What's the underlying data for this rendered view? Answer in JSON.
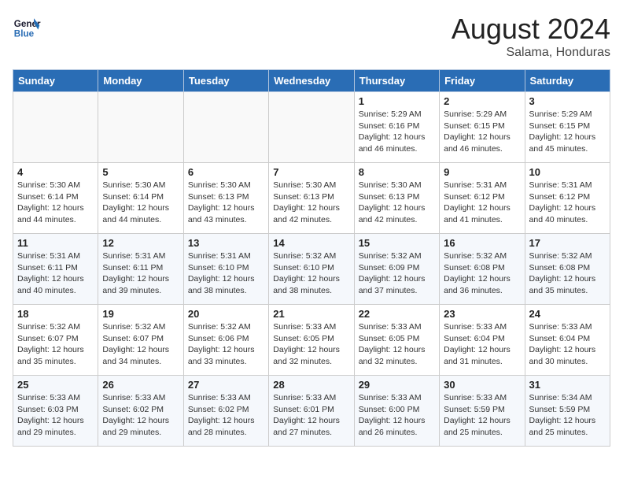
{
  "header": {
    "logo_general": "General",
    "logo_blue": "Blue",
    "month_year": "August 2024",
    "location": "Salama, Honduras"
  },
  "weekdays": [
    "Sunday",
    "Monday",
    "Tuesday",
    "Wednesday",
    "Thursday",
    "Friday",
    "Saturday"
  ],
  "weeks": [
    [
      {
        "day": "",
        "info": ""
      },
      {
        "day": "",
        "info": ""
      },
      {
        "day": "",
        "info": ""
      },
      {
        "day": "",
        "info": ""
      },
      {
        "day": "1",
        "info": "Sunrise: 5:29 AM\nSunset: 6:16 PM\nDaylight: 12 hours\nand 46 minutes."
      },
      {
        "day": "2",
        "info": "Sunrise: 5:29 AM\nSunset: 6:15 PM\nDaylight: 12 hours\nand 46 minutes."
      },
      {
        "day": "3",
        "info": "Sunrise: 5:29 AM\nSunset: 6:15 PM\nDaylight: 12 hours\nand 45 minutes."
      }
    ],
    [
      {
        "day": "4",
        "info": "Sunrise: 5:30 AM\nSunset: 6:14 PM\nDaylight: 12 hours\nand 44 minutes."
      },
      {
        "day": "5",
        "info": "Sunrise: 5:30 AM\nSunset: 6:14 PM\nDaylight: 12 hours\nand 44 minutes."
      },
      {
        "day": "6",
        "info": "Sunrise: 5:30 AM\nSunset: 6:13 PM\nDaylight: 12 hours\nand 43 minutes."
      },
      {
        "day": "7",
        "info": "Sunrise: 5:30 AM\nSunset: 6:13 PM\nDaylight: 12 hours\nand 42 minutes."
      },
      {
        "day": "8",
        "info": "Sunrise: 5:30 AM\nSunset: 6:13 PM\nDaylight: 12 hours\nand 42 minutes."
      },
      {
        "day": "9",
        "info": "Sunrise: 5:31 AM\nSunset: 6:12 PM\nDaylight: 12 hours\nand 41 minutes."
      },
      {
        "day": "10",
        "info": "Sunrise: 5:31 AM\nSunset: 6:12 PM\nDaylight: 12 hours\nand 40 minutes."
      }
    ],
    [
      {
        "day": "11",
        "info": "Sunrise: 5:31 AM\nSunset: 6:11 PM\nDaylight: 12 hours\nand 40 minutes."
      },
      {
        "day": "12",
        "info": "Sunrise: 5:31 AM\nSunset: 6:11 PM\nDaylight: 12 hours\nand 39 minutes."
      },
      {
        "day": "13",
        "info": "Sunrise: 5:31 AM\nSunset: 6:10 PM\nDaylight: 12 hours\nand 38 minutes."
      },
      {
        "day": "14",
        "info": "Sunrise: 5:32 AM\nSunset: 6:10 PM\nDaylight: 12 hours\nand 38 minutes."
      },
      {
        "day": "15",
        "info": "Sunrise: 5:32 AM\nSunset: 6:09 PM\nDaylight: 12 hours\nand 37 minutes."
      },
      {
        "day": "16",
        "info": "Sunrise: 5:32 AM\nSunset: 6:08 PM\nDaylight: 12 hours\nand 36 minutes."
      },
      {
        "day": "17",
        "info": "Sunrise: 5:32 AM\nSunset: 6:08 PM\nDaylight: 12 hours\nand 35 minutes."
      }
    ],
    [
      {
        "day": "18",
        "info": "Sunrise: 5:32 AM\nSunset: 6:07 PM\nDaylight: 12 hours\nand 35 minutes."
      },
      {
        "day": "19",
        "info": "Sunrise: 5:32 AM\nSunset: 6:07 PM\nDaylight: 12 hours\nand 34 minutes."
      },
      {
        "day": "20",
        "info": "Sunrise: 5:32 AM\nSunset: 6:06 PM\nDaylight: 12 hours\nand 33 minutes."
      },
      {
        "day": "21",
        "info": "Sunrise: 5:33 AM\nSunset: 6:05 PM\nDaylight: 12 hours\nand 32 minutes."
      },
      {
        "day": "22",
        "info": "Sunrise: 5:33 AM\nSunset: 6:05 PM\nDaylight: 12 hours\nand 32 minutes."
      },
      {
        "day": "23",
        "info": "Sunrise: 5:33 AM\nSunset: 6:04 PM\nDaylight: 12 hours\nand 31 minutes."
      },
      {
        "day": "24",
        "info": "Sunrise: 5:33 AM\nSunset: 6:04 PM\nDaylight: 12 hours\nand 30 minutes."
      }
    ],
    [
      {
        "day": "25",
        "info": "Sunrise: 5:33 AM\nSunset: 6:03 PM\nDaylight: 12 hours\nand 29 minutes."
      },
      {
        "day": "26",
        "info": "Sunrise: 5:33 AM\nSunset: 6:02 PM\nDaylight: 12 hours\nand 29 minutes."
      },
      {
        "day": "27",
        "info": "Sunrise: 5:33 AM\nSunset: 6:02 PM\nDaylight: 12 hours\nand 28 minutes."
      },
      {
        "day": "28",
        "info": "Sunrise: 5:33 AM\nSunset: 6:01 PM\nDaylight: 12 hours\nand 27 minutes."
      },
      {
        "day": "29",
        "info": "Sunrise: 5:33 AM\nSunset: 6:00 PM\nDaylight: 12 hours\nand 26 minutes."
      },
      {
        "day": "30",
        "info": "Sunrise: 5:33 AM\nSunset: 5:59 PM\nDaylight: 12 hours\nand 25 minutes."
      },
      {
        "day": "31",
        "info": "Sunrise: 5:34 AM\nSunset: 5:59 PM\nDaylight: 12 hours\nand 25 minutes."
      }
    ]
  ]
}
